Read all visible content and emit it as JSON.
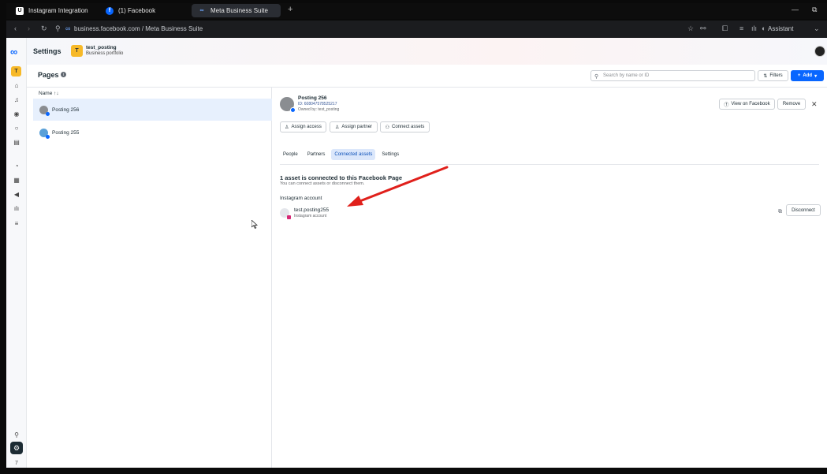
{
  "browser": {
    "tabs": [
      {
        "label": "Instagram Integration"
      },
      {
        "label": "(1) Facebook"
      },
      {
        "label": "Meta Business Suite"
      }
    ],
    "url": "business.facebook.com / Meta Business Suite",
    "assistant_label": "Assistant"
  },
  "app": {
    "settings_title": "Settings",
    "portfolio": {
      "badge": "T",
      "name": "test_posting",
      "subtitle": "Business portfolio"
    },
    "rail_badge": "T",
    "rail_bottom_number": "7"
  },
  "pages_header": {
    "title": "Pages",
    "search_placeholder": "Search by name or ID",
    "filters_label": "Filters",
    "add_label": "Add"
  },
  "page_list": {
    "header": "Name ↑↓",
    "items": [
      {
        "label": "Posting 256",
        "selected": true
      },
      {
        "label": "Posting 255",
        "selected": false
      }
    ]
  },
  "detail": {
    "page_name": "Posting 256",
    "page_id": "ID: 608047578525217",
    "owner": "Owned by: test_posting",
    "view_on_facebook": "View on Facebook",
    "remove": "Remove",
    "assign_access": "Assign access",
    "assign_partner": "Assign partner",
    "connect_assets": "Connect assets",
    "tabs": [
      {
        "label": "People"
      },
      {
        "label": "Partners"
      },
      {
        "label": "Connected assets"
      },
      {
        "label": "Settings"
      }
    ],
    "assets_title": "1 asset is connected to this Facebook Page",
    "assets_sub": "You can connect assets or disconnect them.",
    "section_label": "Instagram account",
    "asset": {
      "name": "test.posting255",
      "type": "Instagram account"
    },
    "disconnect": "Disconnect"
  },
  "colors": {
    "accent": "#0866ff",
    "annotation_arrow": "#e0201b",
    "selected_row": "#e7f0fd"
  }
}
